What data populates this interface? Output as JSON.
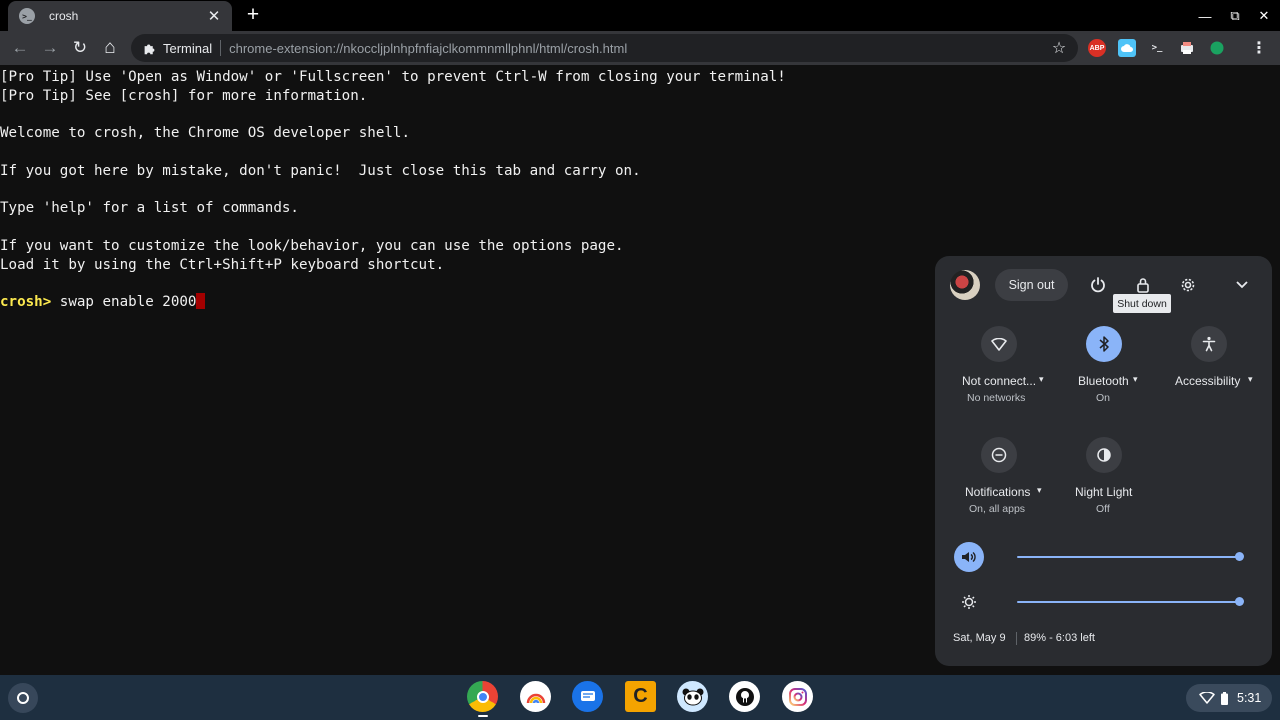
{
  "browser": {
    "tab": {
      "favicon": ">_",
      "title": "crosh",
      "close": "✕"
    },
    "new_tab": "+",
    "window_controls": {
      "minimize": "—",
      "maximize": "⧉",
      "close": "✕"
    },
    "nav": {
      "back": "←",
      "forward": "→",
      "reload": "↻",
      "home": "⌂"
    },
    "omnibox": {
      "origin": "Terminal",
      "url": "chrome-extension://nkoccljplnhpfnfiajclkommnmllphnl/html/crosh.html",
      "bookmark": "☆"
    },
    "extensions": {
      "abp": "ABP",
      "terminal": ">_",
      "more": "⋮"
    }
  },
  "terminal": {
    "lines": [
      "[Pro Tip] Use 'Open as Window' or 'Fullscreen' to prevent Ctrl-W from closing your terminal!",
      "[Pro Tip] See [crosh] for more information.",
      "",
      "Welcome to crosh, the Chrome OS developer shell.",
      "",
      "If you got here by mistake, don't panic!  Just close this tab and carry on.",
      "",
      "Type 'help' for a list of commands.",
      "",
      "If you want to customize the look/behavior, you can use the options page.",
      "Load it by using the Ctrl+Shift+P keyboard shortcut."
    ],
    "prompt": "crosh>",
    "command": " swap enable 2000"
  },
  "quick_settings": {
    "sign_out": "Sign out",
    "tooltip": "Shut down",
    "tiles": [
      {
        "label": "Not connect...",
        "sub": "No networks",
        "on": false
      },
      {
        "label": "Bluetooth",
        "sub": "On",
        "on": true
      },
      {
        "label": "Accessibility",
        "sub": "",
        "on": false
      },
      {
        "label": "Notifications",
        "sub": "On, all apps",
        "on": false
      },
      {
        "label": "Night Light",
        "sub": "Off",
        "on": false
      }
    ],
    "volume_level": 1.0,
    "brightness_level": 1.0,
    "date": "Sat, May 9",
    "battery": "89% - 6:03 left"
  },
  "shelf": {
    "time": "5:31",
    "apps": [
      "chrome",
      "photos",
      "messages",
      "c-app",
      "panda-app",
      "github",
      "instagram"
    ]
  },
  "colors": {
    "accent": "#8ab4f8",
    "prompt": "#fce94f",
    "cursor": "#a30000"
  }
}
